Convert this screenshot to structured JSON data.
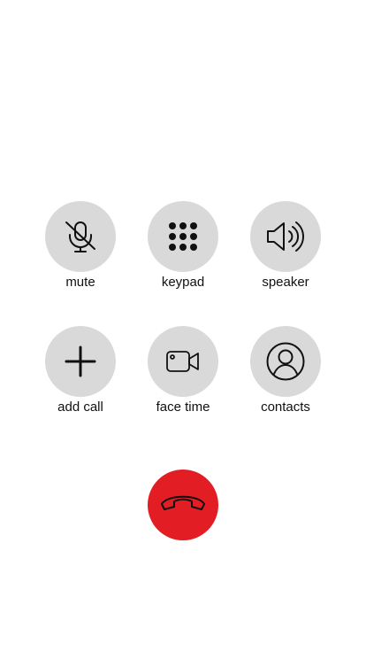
{
  "buttons": {
    "mute": {
      "label": "mute",
      "icon": "mic-off-icon"
    },
    "keypad": {
      "label": "keypad",
      "icon": "keypad-icon"
    },
    "speaker": {
      "label": "speaker",
      "icon": "speaker-icon"
    },
    "add_call": {
      "label": "add call",
      "icon": "plus-icon"
    },
    "face_time": {
      "label": "face time",
      "icon": "video-camera-icon"
    },
    "contacts": {
      "label": "contacts",
      "icon": "user-circle-icon"
    }
  },
  "end_call": {
    "icon": "phone-hangup-icon"
  },
  "colors": {
    "button_bg": "#d9d9d9",
    "end_call_bg": "#e21d24",
    "icon": "#111111"
  }
}
